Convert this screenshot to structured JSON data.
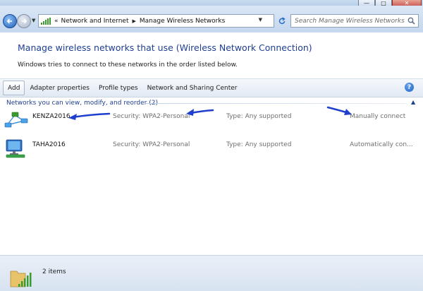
{
  "window": {
    "minimize_glyph": "—",
    "maximize_glyph": "□",
    "close_glyph": "✕"
  },
  "navigation": {
    "back_icon": "back-arrow-icon",
    "forward_icon": "forward-arrow-icon",
    "breadcrumb_prefix": "«",
    "breadcrumbs": [
      "Network and Internet",
      "Manage Wireless Networks"
    ],
    "search_placeholder": "Search Manage Wireless Networks"
  },
  "header": {
    "title": "Manage wireless networks that use (Wireless Network Connection)",
    "subtitle": "Windows tries to connect to these networks in the order listed below."
  },
  "toolbar": {
    "add_label": "Add",
    "adapter_properties_label": "Adapter properties",
    "profile_types_label": "Profile types",
    "sharing_center_label": "Network and Sharing Center",
    "help_glyph": "?"
  },
  "group": {
    "title": "Networks you can view, modify, and reorder (2)",
    "collapse_glyph": "▲"
  },
  "networks": [
    {
      "name": "KENZA2016",
      "security": "Security:  WPA2-Personal",
      "type": "Type:  Any supported",
      "mode": "Manually connect"
    },
    {
      "name": "TAHA2016",
      "security": "Security:  WPA2-Personal",
      "type": "Type:  Any supported",
      "mode": "Automatically con..."
    }
  ],
  "status": {
    "item_count": "2 items"
  },
  "colors": {
    "heading_blue": "#1e3e92",
    "annotation_blue": "#1f3fcf",
    "chrome_blue": "#c4d7ee"
  }
}
